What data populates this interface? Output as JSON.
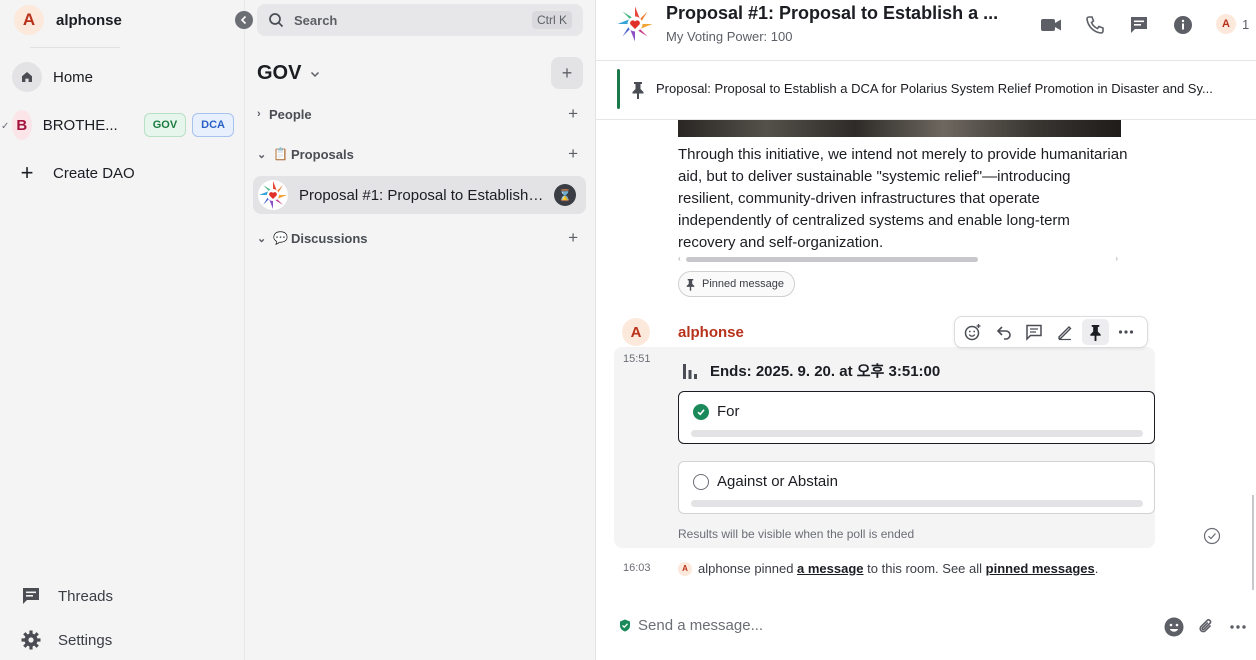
{
  "user": {
    "initial": "A",
    "name": "alphonse"
  },
  "rail": {
    "home": "Home",
    "space": {
      "initial": "B",
      "name": "BROTHE...",
      "tags": [
        "GOV",
        "DCA"
      ]
    },
    "create": "Create DAO",
    "threads": "Threads",
    "settings": "Settings"
  },
  "search": {
    "placeholder": "Search",
    "shortcut": "Ctrl K"
  },
  "space_title": "GOV",
  "sections": {
    "people": "People",
    "proposals": "Proposals",
    "proposals_emoji": "📋",
    "discussions": "Discussions",
    "discussions_emoji": "💬"
  },
  "active_room": {
    "name": "Proposal #1: Proposal to Establish a DCA for Polarius System Relief Promotion in Disaster and Sy..."
  },
  "room": {
    "title": "Proposal #1: Proposal to Establish a ...",
    "subtitle": "My Voting Power: 100",
    "member_initial": "A",
    "member_count": "1"
  },
  "pinned_banner": "Proposal: Proposal to Establish a DCA for Polarius System Relief Promotion in Disaster and Sy...",
  "message_body": "Through this initiative, we intend not merely to provide humanitarian aid, but to deliver sustainable \"systemic relief\"—introducing resilient, community-driven infrastructures that operate independently of centralized systems and enable long-term recovery and self-organization.",
  "pinned_chip": "Pinned message",
  "poll_message": {
    "sender_initial": "A",
    "sender": "alphonse",
    "time": "15:51",
    "question": "Ends: 2025. 9. 20. at 오후 3:51:00",
    "options": [
      {
        "label": "For",
        "selected": true
      },
      {
        "label": "Against or Abstain",
        "selected": false
      }
    ],
    "note": "Results will be visible when the poll is ended"
  },
  "event": {
    "time": "16:03",
    "initial": "A",
    "prefix": "alphonse pinned ",
    "link1": "a message",
    "middle": " to this room. See all ",
    "link2": "pinned messages",
    "suffix": "."
  },
  "composer": {
    "placeholder": "Send a message..."
  },
  "colors": {
    "accent_green": "#1b8a5a",
    "sender_color": "#b8311a",
    "space_color": "#a3133d"
  }
}
